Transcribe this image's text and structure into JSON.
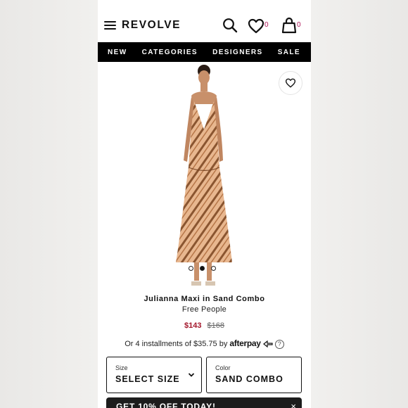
{
  "header": {
    "logo": "REVOLVE",
    "wishlist_count": "0",
    "bag_count": "0"
  },
  "nav": {
    "items": [
      "NEW",
      "CATEGORIES",
      "DESIGNERS",
      "SALE"
    ]
  },
  "product": {
    "name": "Julianna Maxi in Sand Combo",
    "brand": "Free People",
    "price_sale": "$143",
    "price_original": "$168",
    "installments_text": "Or 4 installments of $35.75 by",
    "installments_provider": "afterpay",
    "installments_info": "?",
    "image_count": 3,
    "active_image": 2
  },
  "selectors": {
    "size_label": "Size",
    "size_value": "SELECT SIZE",
    "color_label": "Color",
    "color_value": "SAND COMBO"
  },
  "promo": {
    "text": "GET 10% OFF TODAY!",
    "close": "×"
  },
  "colors": {
    "accent": "#b0185b",
    "sale": "#a3162b",
    "nav_bg": "#000000"
  }
}
